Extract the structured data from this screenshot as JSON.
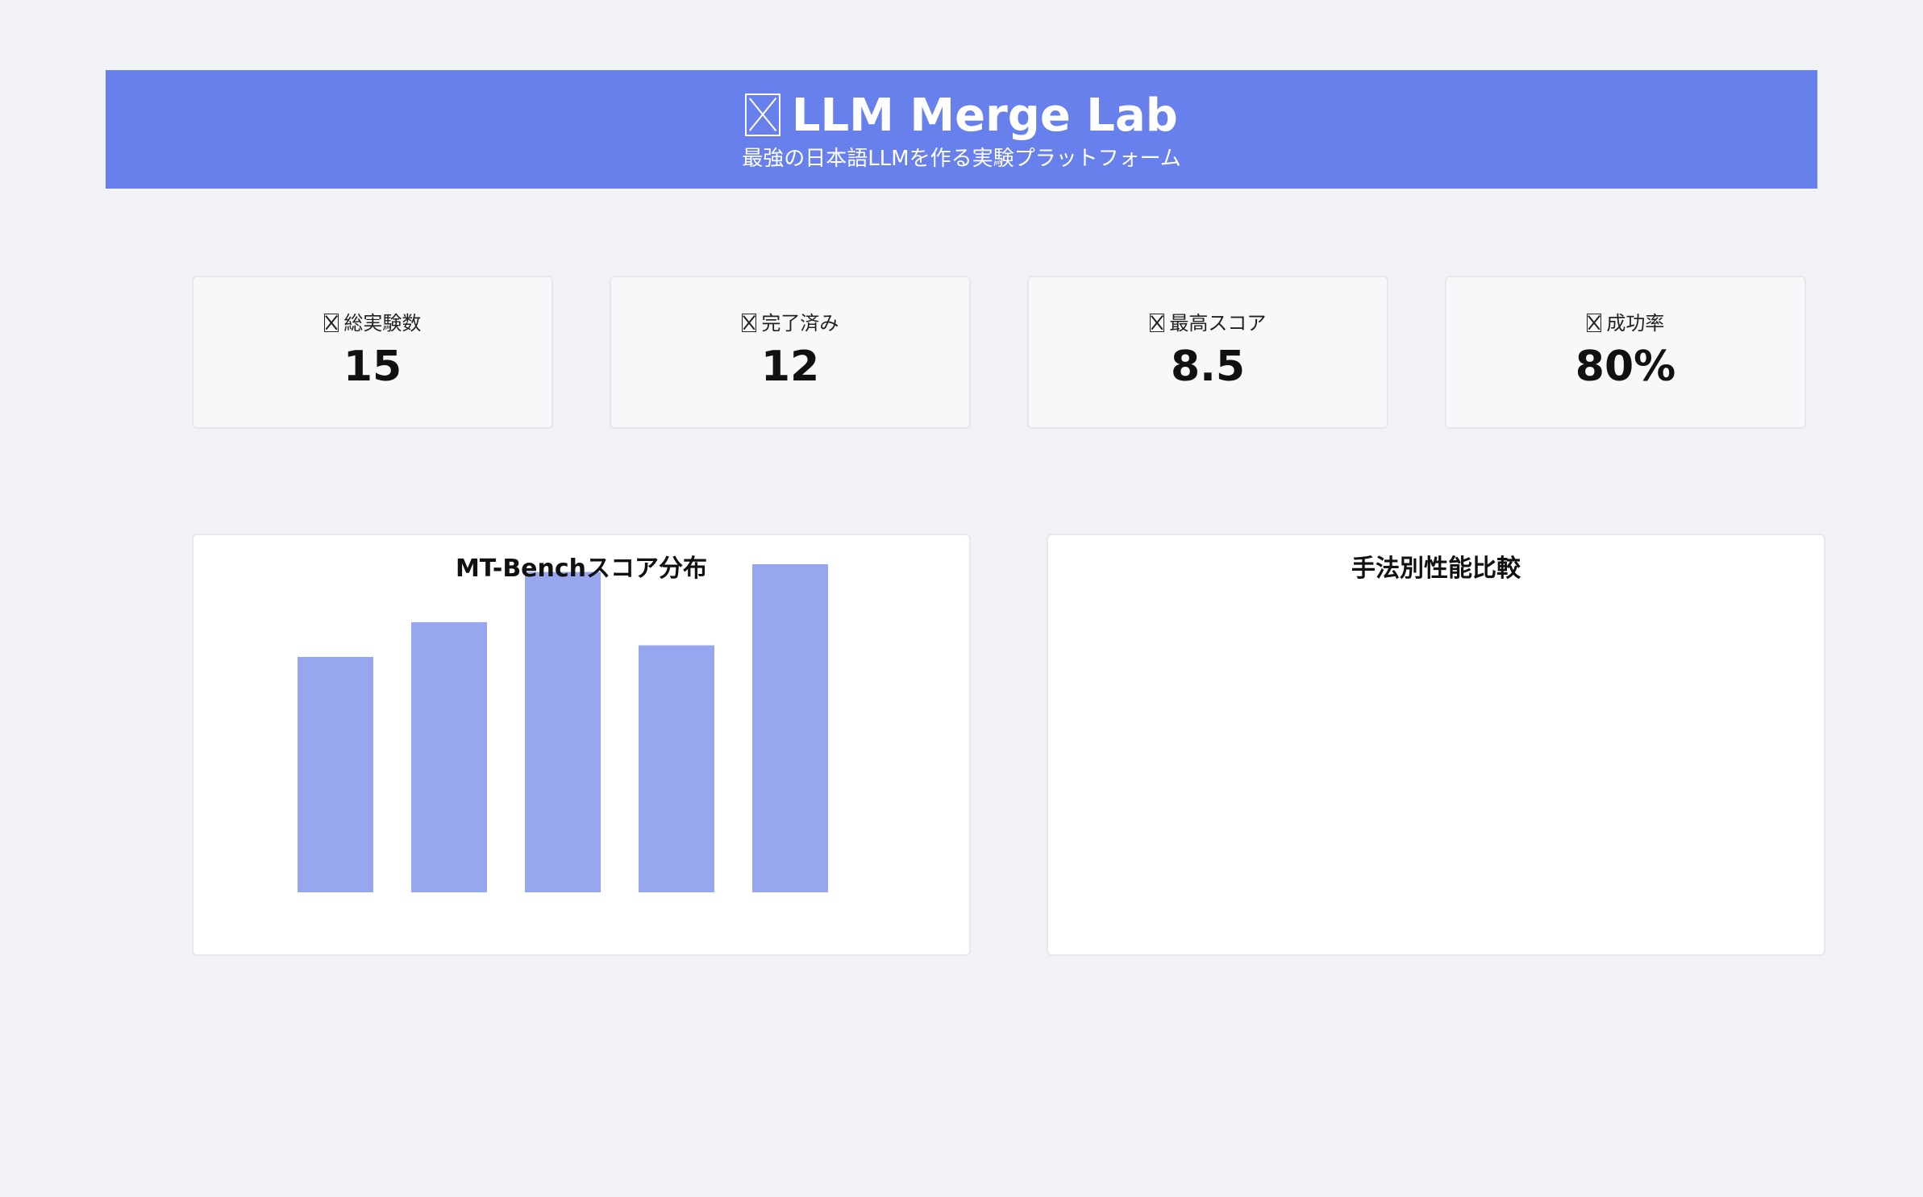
{
  "header": {
    "icon": "flask-icon",
    "title": "LLM Merge Lab",
    "subtitle": "最強の日本語LLMを作る実験プラットフォーム",
    "background_color": "#6880ec"
  },
  "stats": [
    {
      "icon": "experiment-icon",
      "label": "総実験数",
      "value": "15"
    },
    {
      "icon": "check-icon",
      "label": "完了済み",
      "value": "12"
    },
    {
      "icon": "trophy-icon",
      "label": "最高スコア",
      "value": "8.5"
    },
    {
      "icon": "chart-icon",
      "label": "成功率",
      "value": "80%"
    }
  ],
  "charts": {
    "score_distribution": {
      "title": "MT-Benchスコア分布"
    },
    "method_comparison": {
      "title": "手法別性能比較"
    }
  },
  "chart_data": [
    {
      "type": "bar",
      "title": "MT-Benchスコア分布",
      "values": [
        6.1,
        7.0,
        8.3,
        6.4,
        8.5
      ],
      "ylim": [
        0,
        8.5
      ],
      "xlabel": "",
      "ylabel": "",
      "bar_color": "#96a6ef",
      "grid": false
    },
    {
      "type": "bar",
      "title": "手法別性能比較",
      "values": []
    }
  ]
}
